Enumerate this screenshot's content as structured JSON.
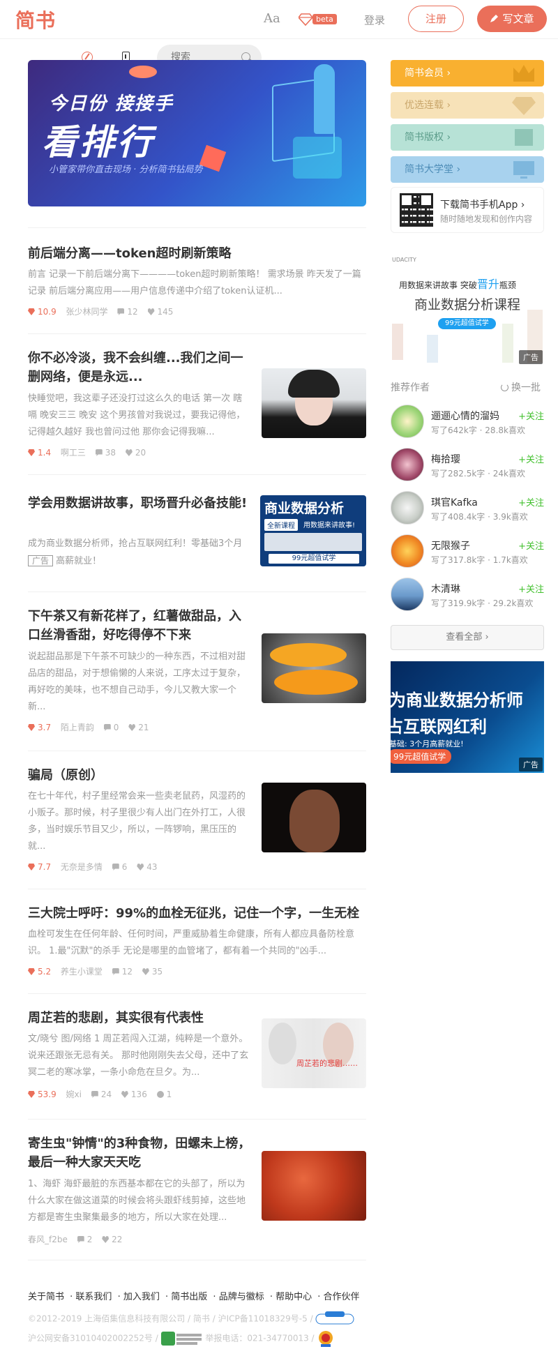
{
  "header": {
    "logo": "简书",
    "font_toggle": "Aa",
    "beta_badge": "beta",
    "login": "登录",
    "register": "注册",
    "write": "写文章",
    "search_placeholder": "搜索"
  },
  "banner": {
    "line1": "今日份 接接手",
    "line2": "看排行",
    "line3": "小管家带你直击现场 · 分析简书钻局势"
  },
  "articles": [
    {
      "title": "前后端分离——token超时刷新策略",
      "abstract": "前言 记录一下前后端分离下————token超时刷新策略！ 需求场景 昨天发了一篇记录 前后端分离应用——用户信息传递中介绍了token认证机...",
      "jsd": "10.9",
      "author": "张少林同学",
      "comments": "12",
      "likes": "145"
    },
    {
      "title": "你不必冷淡，我不会纠缠...我们之间一删网络，便是永远...",
      "abstract": "快睡觉吧，我这辈子还没打过这么久的电话 第一次 瞎嗝 晚安三三 晚安 这个男孩曾对我说过，要我记得他，记得越久越好 我也曾问过他 那你会记得我嘛...",
      "jsd": "1.4",
      "author": "啊工三",
      "comments": "38",
      "likes": "20"
    },
    {
      "title": "学会用数据讲故事，职场晋升必备技能!",
      "abstract": "成为商业数据分析师，抢占互联网红利！零基础3个月",
      "ad_badge": "广告",
      "abstract_tail": "高薪就业！"
    },
    {
      "title": "下午茶又有新花样了，红薯做甜品，入口丝滑香甜，好吃得停不下来",
      "abstract": "说起甜品那是下午茶不可缺少的一种东西，不过相对甜品店的甜品，对于想偷懒的人来说，工序太过于复杂，再好吃的美味，也不想自己动手，今儿又教大家一个新...",
      "jsd": "3.7",
      "author": "陌上青韵",
      "comments": "0",
      "likes": "21"
    },
    {
      "title": "骗局（原创）",
      "abstract": "在七十年代，村子里经常会来一些卖老鼠药，风湿药的小贩子。那时候，村子里很少有人出门在外打工，人很多，当时娱乐节目又少，所以，一阵锣响，黑压压的就...",
      "jsd": "7.7",
      "author": "无奈是多情",
      "comments": "6",
      "likes": "43"
    },
    {
      "title": "三大院士呼吁：99%的血栓无征兆，记住一个字，一生无栓",
      "abstract": "血栓可发生在任何年龄、任何时间，严重威胁着生命健康，所有人都应具备防栓意识。 1.最\"沉默\"的杀手 无论是哪里的血管堵了，都有着一个共同的\"凶手...",
      "jsd": "5.2",
      "author": "养生小课堂",
      "comments": "12",
      "likes": "35"
    },
    {
      "title": "周芷若的悲剧，其实很有代表性",
      "abstract": "文/晓兮 图/网络 1 周芷若闯入江湖，纯粹是一个意外。说来还跟张无忌有关。 那时他刚刚失去父母，还中了玄冥二老的寒冰掌，一条小命危在旦夕。为...",
      "jsd": "53.9",
      "author": "婉xi",
      "comments": "24",
      "likes": "136",
      "rewards": "1",
      "thumb_text": "周芷若的悲剧……"
    },
    {
      "title": "寄生虫\"钟情\"的3种食物，田螺未上榜，最后一种大家天天吃",
      "abstract": "1、海虾 海虾最脏的东西基本都在它的头部了，所以为什么大家在做这道菜的时候会将头跟虾线剪掉，这些地方都是寄生虫聚集最多的地方，所以大家在处理...",
      "author": "春风_f2be",
      "comments": "2",
      "likes": "22"
    }
  ],
  "ad_thumb": {
    "line1": "商业数据分析",
    "line2a": "全新课程",
    "line2b": "用数据来讲故事!",
    "line3": "99元超值试学"
  },
  "sidebar": {
    "boards": [
      {
        "label": "简书会员 ›",
        "color": "#f9b030"
      },
      {
        "label": "优选连载 ›",
        "color": "#f7e2b8"
      },
      {
        "label": "简书版权 ›",
        "color": "#b7e2d6"
      },
      {
        "label": "简书大学堂 ›",
        "color": "#a8d2ee"
      }
    ],
    "app_title": "下载简书手机App ›",
    "app_sub": "随时随地发现和创作内容",
    "ad1": {
      "small": "UDACITY",
      "line1": "用数据来讲故事 突破",
      "line1b": "晋升",
      "line1c": "瓶颈",
      "line2": "商业数据分析课程",
      "line3": "99元超值试学",
      "label": "广告"
    },
    "recommend_title": "推荐作者",
    "recommend_switch": "换一批",
    "authors": [
      {
        "name": "逦逦心情的溜妈",
        "desc": "写了642k字 · 28.8k喜欢",
        "follow": "+关注"
      },
      {
        "name": "梅拾璎",
        "desc": "写了282.5k字 · 24k喜欢",
        "follow": "+关注"
      },
      {
        "name": "琪官Kafka",
        "desc": "写了408.4k字 · 3.9k喜欢",
        "follow": "+关注"
      },
      {
        "name": "无限猴子",
        "desc": "写了317.8k字 · 1.7k喜欢",
        "follow": "+关注"
      },
      {
        "name": "木清琳",
        "desc": "写了319.9k字 · 29.2k喜欢",
        "follow": "+关注"
      }
    ],
    "see_all": "查看全部 ›",
    "ad2": {
      "line1": "为商业数据分析师",
      "line2": "占互联网红利",
      "line3": "基础: 3个月高薪就业!",
      "line4": "99元超值试学",
      "label": "广告"
    }
  },
  "footer": {
    "links": [
      "关于简书",
      "联系我们",
      "加入我们",
      "简书出版",
      "品牌与徽标",
      "帮助中心",
      "合作伙伴"
    ],
    "line2": "©2012-2019 上海佰集信息科技有限公司 / 简书 / 沪ICP备11018329号-5 /",
    "line3a": "沪公网安备31010402002252号 /",
    "line3b": "举报电话：021-34770013 /"
  },
  "colors": {
    "brand": "#ea6f5a",
    "follow_green": "#42c02e"
  }
}
